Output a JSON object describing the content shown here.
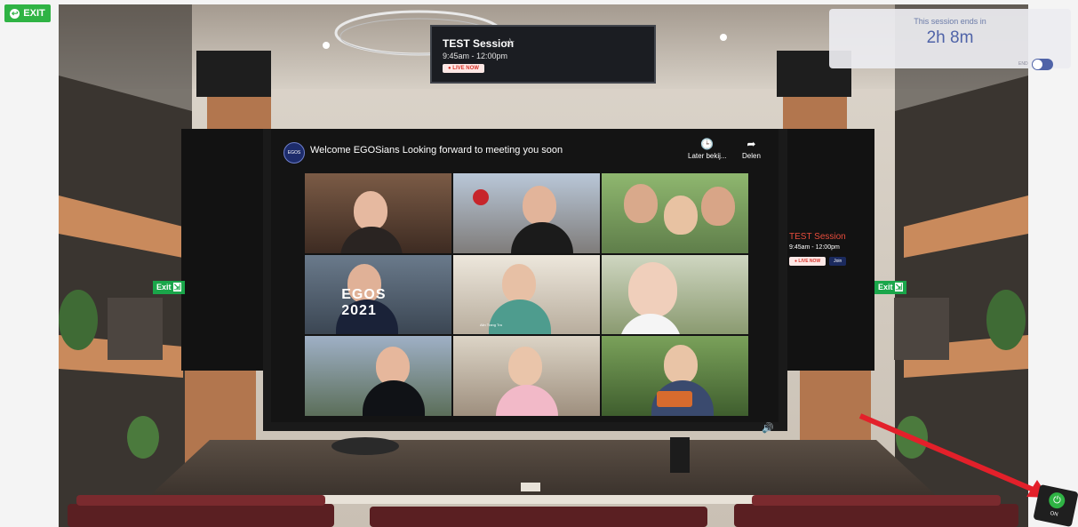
{
  "exit_button": {
    "label": "EXIT",
    "icon": "exit-icon"
  },
  "top_banner": {
    "title": "TEST Session",
    "time": "9:45am - 12:00pm",
    "live_badge": "LIVE NOW",
    "icon": "star-icon"
  },
  "countdown": {
    "label": "This session ends in",
    "value": "2h 8m",
    "toggle_label": "END"
  },
  "video": {
    "channel_logo_text": "EGOS",
    "title": "Welcome EGOSians Looking forward to meeting you soon",
    "watch_later_label": "Later bekij...",
    "share_label": "Delen",
    "tile_caption": "EGOS 2021",
    "tile_name_label": "Alin Trang Tra"
  },
  "side_card": {
    "title": "TEST Session",
    "time": "9:45am - 12:00pm",
    "live_badge": "LIVE NOW",
    "join_label": "Join"
  },
  "exit_signs": {
    "left_label": "Exit",
    "right_label": "Exit"
  },
  "on_widget": {
    "label": "ON",
    "icon": "power-icon"
  },
  "colors": {
    "accent_green": "#2fb344",
    "live_red": "#d9342b",
    "brand_blue": "#4f63a8",
    "arrow_red": "#e3202a"
  }
}
